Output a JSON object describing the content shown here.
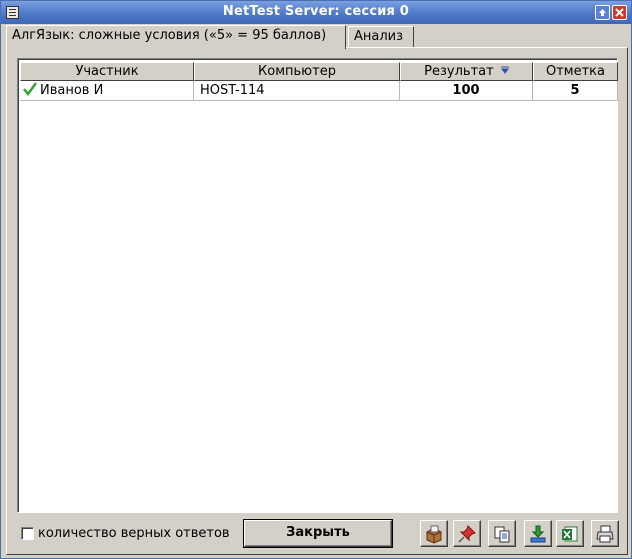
{
  "window": {
    "title": "NetTest Server: сессия 0"
  },
  "tabs": [
    {
      "label": "АлгЯзык: сложные условия («5» = 95 баллов)",
      "active": true
    },
    {
      "label": "Анализ",
      "active": false
    }
  ],
  "table": {
    "columns": [
      "Участник",
      "Компьютер",
      "Результат",
      "Отметка"
    ],
    "sorted_column": "Результат",
    "rows": [
      {
        "status_icon": "check-icon",
        "participant": "Иванов И",
        "computer": "HOST-114",
        "result": "100",
        "mark": "5"
      }
    ]
  },
  "footer": {
    "checkbox_label": "количество верных ответов",
    "checkbox_checked": false,
    "close_label": "Закрыть",
    "toolbar_icons": [
      "archive-icon",
      "pin-icon",
      "copy-icon",
      "download-icon",
      "excel-icon",
      "print-icon"
    ]
  },
  "colors": {
    "titlebar": "#4f78c8",
    "window_bg": "#d4d0c8",
    "check": "#2aa52a",
    "close_button": "#cc3a2a"
  }
}
